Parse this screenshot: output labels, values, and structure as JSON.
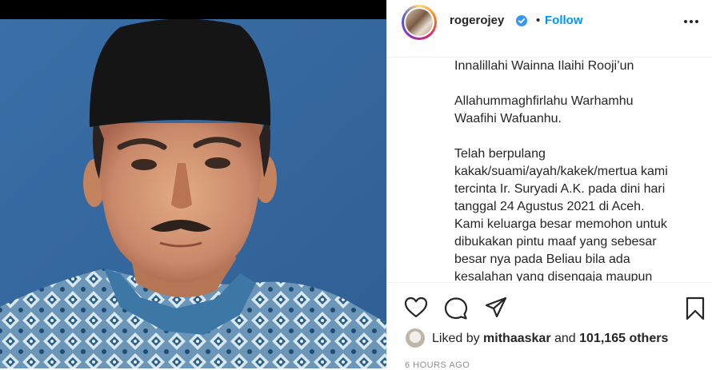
{
  "post": {
    "username": "rogerojey",
    "follow_label": "Follow",
    "separator": "•",
    "caption_lines": [
      "Innalillahi Wainna Ilaihi Rooji’un",
      "",
      "Allahummaghfirlahu Warhamhu",
      "Waafihi Wafuanhu.",
      "",
      "Telah berpulang",
      "kakak/suami/ayah/kakek/mertua kami",
      "tercinta Ir. Suryadi A.K. pada dini hari",
      "tanggal 24 Agustus 2021 di Aceh.",
      "Kami keluarga besar memohon untuk",
      "dibukakan pintu maaf yang sebesar",
      "besar nya pada Beliau bila ada",
      "kesalahan yang disengaja maupun"
    ],
    "likes_prefix": "Liked by",
    "likes_user": "mithaaskar",
    "likes_and": "and",
    "likes_count": "101,165 others",
    "timestamp": "6 HOURS AGO"
  },
  "icons": {
    "verified": "verified-badge-icon",
    "more": "more-options-icon",
    "like": "heart-icon",
    "comment": "comment-icon",
    "share": "paper-plane-icon",
    "save": "bookmark-icon"
  },
  "colors": {
    "link": "#0095f6",
    "text": "#262626",
    "muted": "#8e8e8e",
    "divider": "#efefef"
  }
}
